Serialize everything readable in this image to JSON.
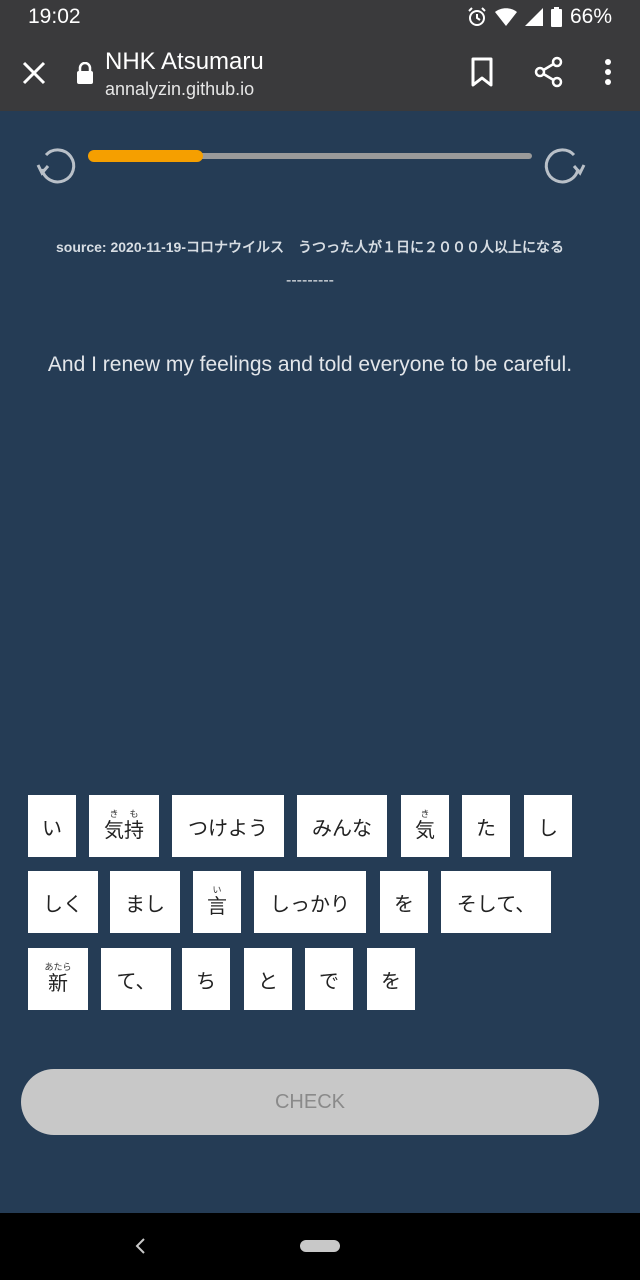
{
  "status_bar": {
    "time": "19:02",
    "battery": "66%"
  },
  "browser": {
    "title": "NHK Atsumaru",
    "url": "annalyzin.github.io"
  },
  "progress": {
    "fraction": 0.26
  },
  "source": "source: 2020-11-19-コロナウイルス　うつった人が１日に２０００人以上になる",
  "divider": "---------",
  "sentence": "And I renew my feelings and told everyone to be careful.",
  "tiles": [
    {
      "text": "い"
    },
    {
      "text": "気持",
      "ruby": [
        "気",
        "き",
        "持",
        "も"
      ]
    },
    {
      "text": "つけよう"
    },
    {
      "text": "みんな"
    },
    {
      "text": "気",
      "ruby": [
        "気",
        "き"
      ]
    },
    {
      "text": "た"
    },
    {
      "text": "し"
    },
    {
      "text": "しく"
    },
    {
      "text": "まし"
    },
    {
      "text": "言",
      "ruby": [
        "言",
        "い"
      ]
    },
    {
      "text": "しっかり"
    },
    {
      "text": "を"
    },
    {
      "text": "そして、"
    },
    {
      "text": "新",
      "ruby": [
        "新",
        "あたら"
      ]
    },
    {
      "text": "て、"
    },
    {
      "text": "ち"
    },
    {
      "text": "と"
    },
    {
      "text": "で"
    },
    {
      "text": "を"
    }
  ],
  "check_label": "CHECK"
}
